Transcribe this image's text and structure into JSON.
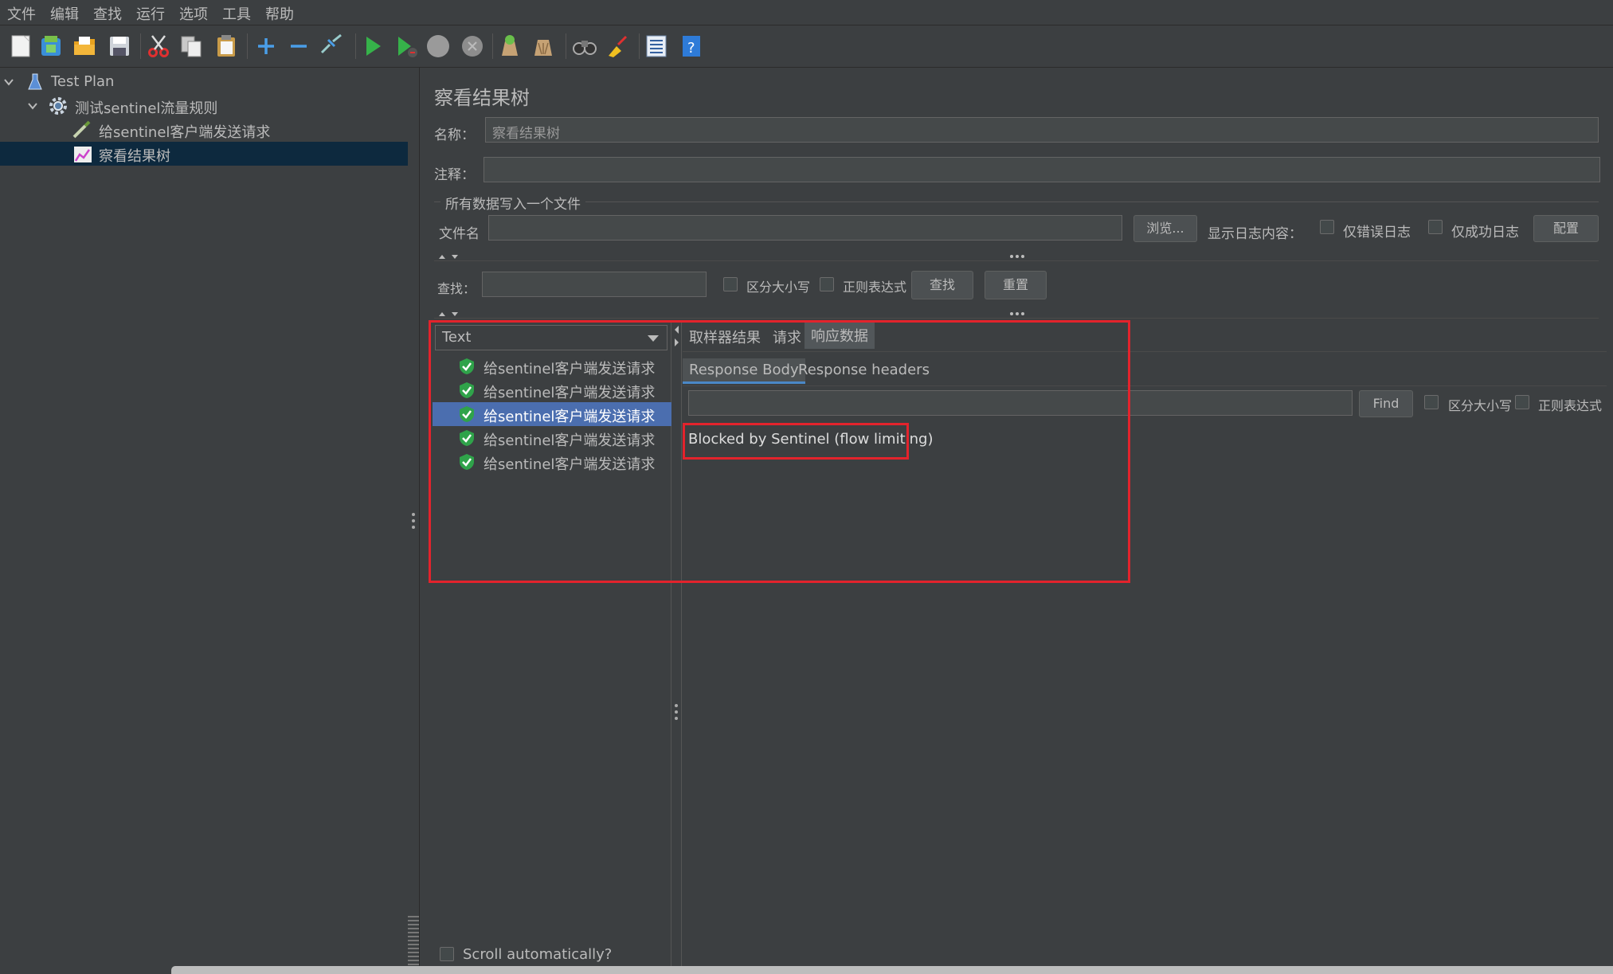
{
  "menu": [
    "文件",
    "编辑",
    "查找",
    "运行",
    "选项",
    "工具",
    "帮助"
  ],
  "tree": {
    "root": "Test Plan",
    "thread_group": "测试sentinel流量规则",
    "sampler": "给sentinel客户端发送请求",
    "listener": "察看结果树"
  },
  "panel": {
    "title": "察看结果树",
    "name_label": "名称：",
    "name_value": "察看结果树",
    "comment_label": "注释：",
    "comment_value": "",
    "file_section": "所有数据写入一个文件",
    "filename_label": "文件名",
    "filename_value": "",
    "browse_button": "浏览...",
    "log_display_label": "显示日志内容：",
    "errors_only": "仅错误日志",
    "success_only": "仅成功日志",
    "config_button": "配置"
  },
  "search": {
    "label": "查找：",
    "value": "",
    "case_sensitive": "区分大小写",
    "regex": "正则表达式",
    "find_button": "查找",
    "reset_button": "重置"
  },
  "results": {
    "renderer": "Text",
    "items": [
      "给sentinel客户端发送请求",
      "给sentinel客户端发送请求",
      "给sentinel客户端发送请求",
      "给sentinel客户端发送请求",
      "给sentinel客户端发送请求"
    ],
    "selected_index": 2,
    "scroll_auto": "Scroll automatically?"
  },
  "detail": {
    "tabs": [
      "取样器结果",
      "请求",
      "响应数据"
    ],
    "active_tab": 2,
    "subtabs": [
      "Response Body",
      "Response headers"
    ],
    "active_subtab": 0,
    "find_value": "",
    "find_button": "Find",
    "case_sensitive": "区分大小写",
    "regex": "正则表达式",
    "body": "Blocked by Sentinel (flow limiting)"
  },
  "colors": {
    "background": "#3c3f41",
    "selection": "#4b6eaf",
    "tree_selection": "#0d293e",
    "highlight_box": "#e3232c",
    "success_icon": "#2fa34a"
  }
}
